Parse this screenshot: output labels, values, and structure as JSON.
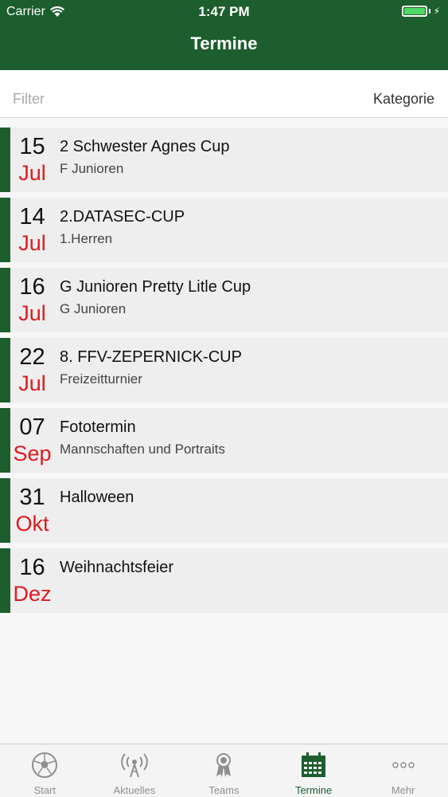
{
  "status": {
    "carrier": "Carrier",
    "time": "1:47 PM"
  },
  "nav": {
    "title": "Termine"
  },
  "filter": {
    "placeholder": "Filter",
    "value": "",
    "category_label": "Kategorie"
  },
  "events": [
    {
      "day": "15",
      "month": "Jul",
      "title": "2 Schwester Agnes Cup",
      "subtitle": "F Junioren"
    },
    {
      "day": "14",
      "month": "Jul",
      "title": "2.DATASEC-CUP",
      "subtitle": "1.Herren"
    },
    {
      "day": "16",
      "month": "Jul",
      "title": "G Junioren Pretty Litle Cup",
      "subtitle": "G Junioren"
    },
    {
      "day": "22",
      "month": "Jul",
      "title": "8. FFV-ZEPERNICK-CUP",
      "subtitle": "Freizeitturnier"
    },
    {
      "day": "07",
      "month": "Sep",
      "title": "Fototermin",
      "subtitle": "Mannschaften und Portraits"
    },
    {
      "day": "31",
      "month": "Okt",
      "title": "Halloween",
      "subtitle": ""
    },
    {
      "day": "16",
      "month": "Dez",
      "title": "Weihnachtsfeier",
      "subtitle": ""
    }
  ],
  "tabs": [
    {
      "label": "Start",
      "icon": "soccer-ball-icon"
    },
    {
      "label": "Aktuelles",
      "icon": "antenna-icon"
    },
    {
      "label": "Teams",
      "icon": "award-ribbon-icon"
    },
    {
      "label": "Termine",
      "icon": "calendar-icon"
    },
    {
      "label": "Mehr",
      "icon": "more-dots-icon"
    }
  ],
  "colors": {
    "brand_green": "#1c5e2d",
    "month_red": "#e0191e",
    "battery_green": "#4cd964"
  }
}
